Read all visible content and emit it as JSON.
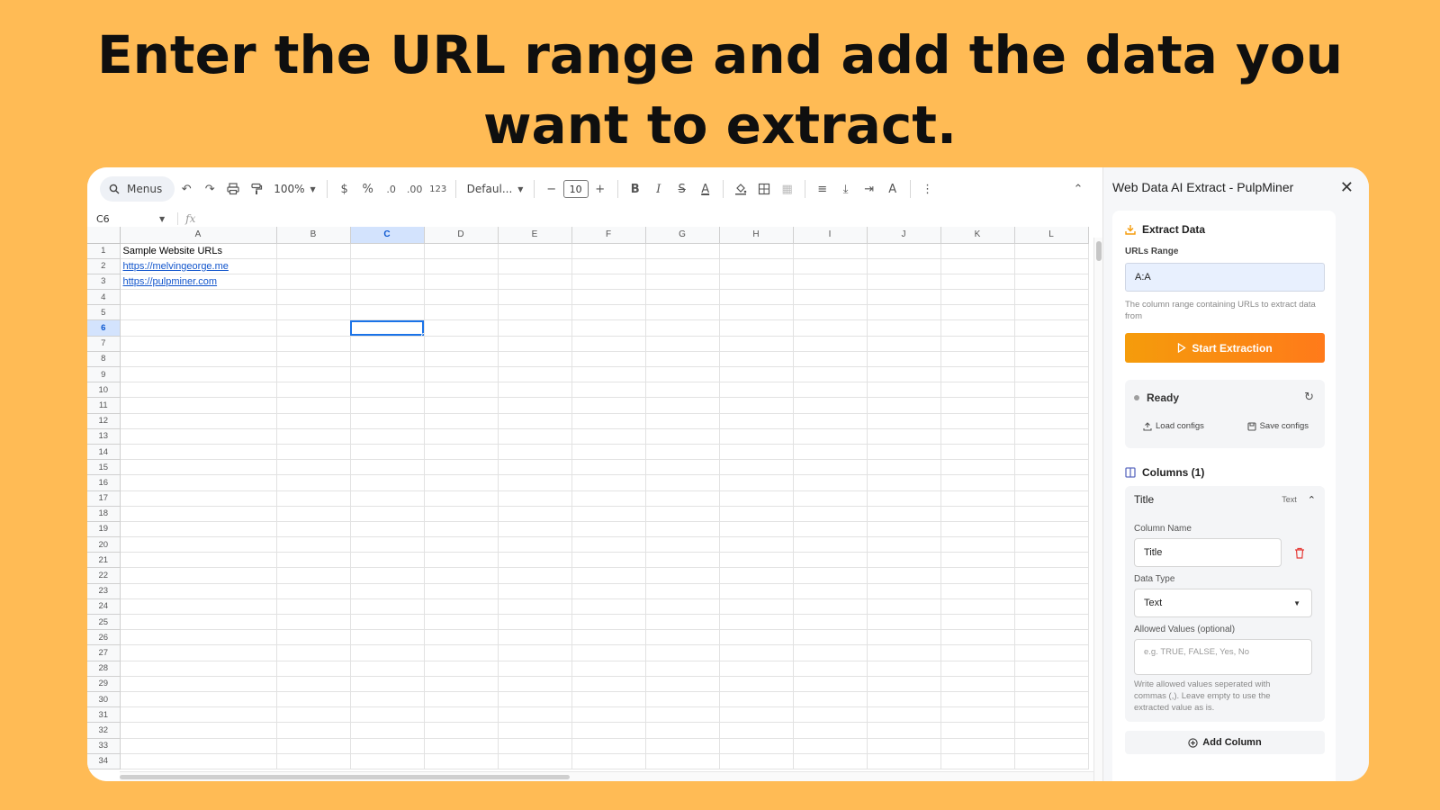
{
  "headline": {
    "line1": "Enter the URL range and add the data you",
    "line2": "want to extract."
  },
  "toolbar": {
    "menus_label": "Menus",
    "zoom": "100%",
    "currency": "$",
    "percent": "%",
    "dec_decrease": ".0",
    "dec_increase": ".00",
    "number_format": "123",
    "font": "Defaul...",
    "font_size": "10",
    "bold": "B",
    "italic": "I",
    "strike": "S",
    "text_color": "A"
  },
  "formula_bar": {
    "cell_ref": "C6",
    "fx": "fx"
  },
  "sheet": {
    "columns": [
      "A",
      "B",
      "C",
      "D",
      "E",
      "F",
      "G",
      "H",
      "I",
      "J",
      "K",
      "L"
    ],
    "selected_column": "C",
    "selected_row": 6,
    "row_count": 34,
    "cells": [
      {
        "row": 1,
        "col": "A",
        "text": "Sample Website URLs",
        "link": false
      },
      {
        "row": 2,
        "col": "A",
        "text": "https://melvingeorge.me",
        "link": true
      },
      {
        "row": 3,
        "col": "A",
        "text": "https://pulpminer.com",
        "link": true
      }
    ]
  },
  "panel": {
    "title": "Web Data AI Extract - PulpMiner",
    "extract": {
      "title": "Extract Data",
      "urls_label": "URLs Range",
      "urls_value": "A:A",
      "urls_hint": "The column range containing URLs to extract data from",
      "start_button": "Start Extraction"
    },
    "status": {
      "state": "Ready",
      "load_configs": "Load configs",
      "save_configs": "Save configs"
    },
    "columns": {
      "title": "Columns (1)",
      "item": {
        "name": "Title",
        "type_badge": "Text",
        "column_name_label": "Column Name",
        "column_name_value": "Title",
        "data_type_label": "Data Type",
        "data_type_value": "Text",
        "allowed_label": "Allowed Values (optional)",
        "allowed_placeholder": "e.g. TRUE, FALSE, Yes, No",
        "allowed_hint": "Write allowed values seperated with commas (,). Leave empty to use the extracted value as is."
      },
      "add_button": "Add Column"
    }
  },
  "colors": {
    "background": "#FFBB55",
    "accent_orange": "#FF7A1A",
    "selection_blue": "#1A73E8",
    "link_blue": "#1155CC",
    "delete_red": "#E53935"
  }
}
